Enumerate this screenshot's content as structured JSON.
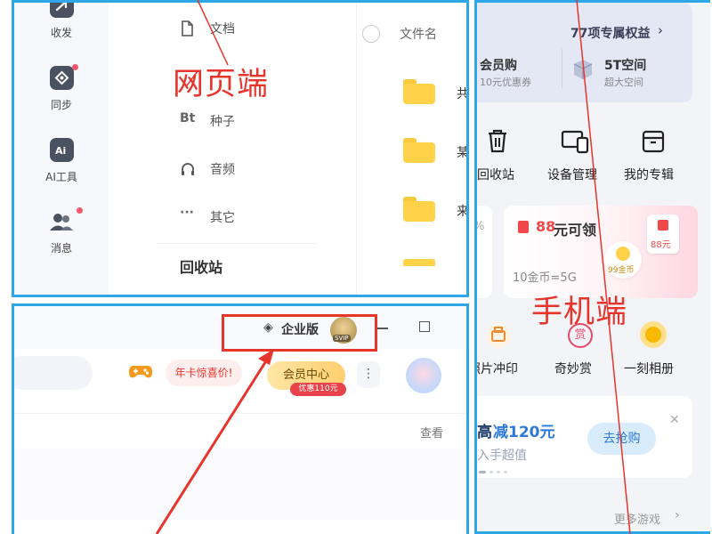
{
  "annotations": {
    "web_label": "网页端",
    "mobile_label": "手机端"
  },
  "web": {
    "rail": [
      {
        "label": "收发",
        "icon": "share-arrow-icon",
        "badge": false
      },
      {
        "label": "同步",
        "icon": "sync-icon",
        "badge": true
      },
      {
        "label": "AI工具",
        "icon": "ai-tools-icon",
        "badge": false
      },
      {
        "label": "消息",
        "icon": "message-icon",
        "badge": true
      }
    ],
    "categories": [
      {
        "label": "文档",
        "icon": "document-icon"
      },
      {
        "label": "种子",
        "icon": "bt-torrent-icon",
        "icon_text": "Bt"
      },
      {
        "label": "音频",
        "icon": "headphones-icon"
      },
      {
        "label": "其它",
        "icon": "more-dots-icon",
        "icon_text": "···"
      },
      {
        "label": "回收站",
        "icon": "trash-icon"
      }
    ],
    "file_header": "文件名",
    "files": [
      {
        "name": "共",
        "icon": "folder-icon"
      },
      {
        "name": "某",
        "icon": "folder-icon"
      },
      {
        "name": "来",
        "icon": "folder-icon"
      }
    ]
  },
  "mobile": {
    "benefits_link": "77项专属权益",
    "benefits": [
      {
        "title": "会员购",
        "subtitle": "10元优惠券"
      },
      {
        "title": "5T空间",
        "subtitle": "超大空间",
        "icon": "cube-icon"
      }
    ],
    "tools": [
      {
        "label": "回收站",
        "icon": "trash-icon"
      },
      {
        "label": "设备管理",
        "icon": "devices-icon"
      },
      {
        "label": "我的专辑",
        "icon": "album-icon"
      }
    ],
    "left_stub": "%",
    "reward": {
      "title_value": "88",
      "title_suffix": "元可领",
      "coin_text": "10金币=5G",
      "envelope_text": "88元",
      "coin_badge": "99金币"
    },
    "services": [
      {
        "label": "照片冲印",
        "icon": "photo-print-icon"
      },
      {
        "label": "奇妙赏",
        "icon": "reward-icon",
        "icon_text": "赏"
      },
      {
        "label": "一刻相册",
        "icon": "moment-album-icon"
      }
    ],
    "promo": {
      "title_prefix": "高",
      "title_highlight": "减120元",
      "subtitle": "入手超值",
      "button": "去抢购"
    },
    "more_games": "更多游戏"
  },
  "desktop": {
    "enterprise": "企业版",
    "avatar_text": "SVIP",
    "promo_tag": "年卡惊喜价!",
    "vip_center": "会员中心",
    "vip_discount": "优惠110元",
    "view_link": "查看"
  },
  "colors": {
    "frame_blue": "#2ea7e8",
    "annotation_red": "#e8352c",
    "folder_yellow": "#ffd24a",
    "promo_red": "#f0484a"
  }
}
